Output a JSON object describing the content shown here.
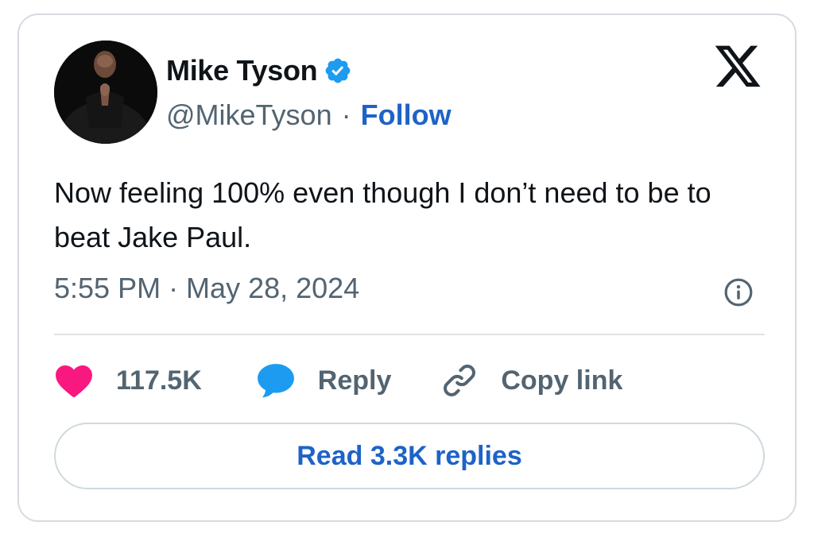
{
  "author": {
    "name": "Mike Tyson",
    "handle": "@MikeTyson",
    "separator": "·",
    "follow_label": "Follow",
    "verified": true
  },
  "tweet": {
    "text": "Now feeling 100% even though I don’t need to be to beat Jake Paul.",
    "timestamp": "5:55 PM · May 28, 2024"
  },
  "actions": {
    "likes": "117.5K",
    "reply_label": "Reply",
    "copy_link_label": "Copy link"
  },
  "read_replies_label": "Read 3.3K replies",
  "icons": {
    "verified": "verified-badge-icon",
    "platform_logo": "x-logo-icon",
    "info": "info-icon",
    "like": "heart-icon",
    "reply": "speech-bubble-icon",
    "copy_link": "link-icon"
  },
  "colors": {
    "link_blue": "#1d63c8",
    "verified_blue": "#1d9bf0",
    "heart_pink": "#f91880",
    "reply_blue": "#1d9bf0",
    "muted_text": "#536471",
    "text": "#0f1419"
  }
}
